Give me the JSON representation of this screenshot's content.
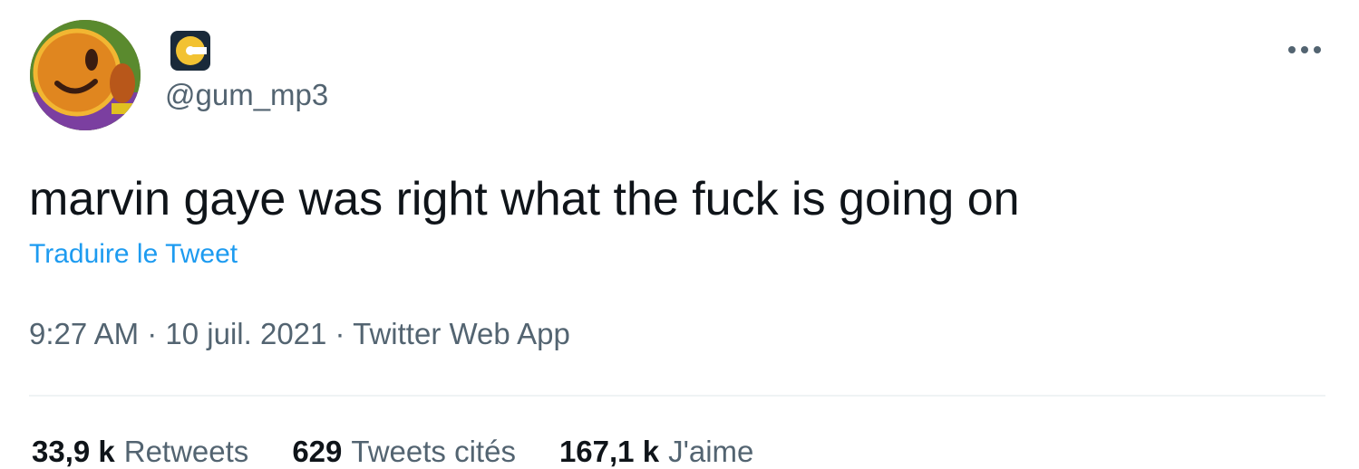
{
  "tweet": {
    "avatar_icon": "cartoon-character-avatar",
    "name_icon": "cd-disc-icon",
    "handle": "@gum_mp3",
    "more_icon": "more-horizontal-icon",
    "text": "marvin gaye was right what the fuck is going on",
    "translate_label": "Traduire le Tweet",
    "time": "9:27 AM",
    "separator": " · ",
    "date": "10 juil. 2021",
    "source": "Twitter Web App"
  },
  "stats": {
    "retweets_count": "33,9 k",
    "retweets_label": "Retweets",
    "quotes_count": "629",
    "quotes_label": "Tweets cités",
    "likes_count": "167,1 k",
    "likes_label": "J'aime"
  },
  "colors": {
    "link": "#1d9bf0",
    "secondary_text": "#536471",
    "primary_text": "#0f1419",
    "divider": "#eff3f4"
  }
}
